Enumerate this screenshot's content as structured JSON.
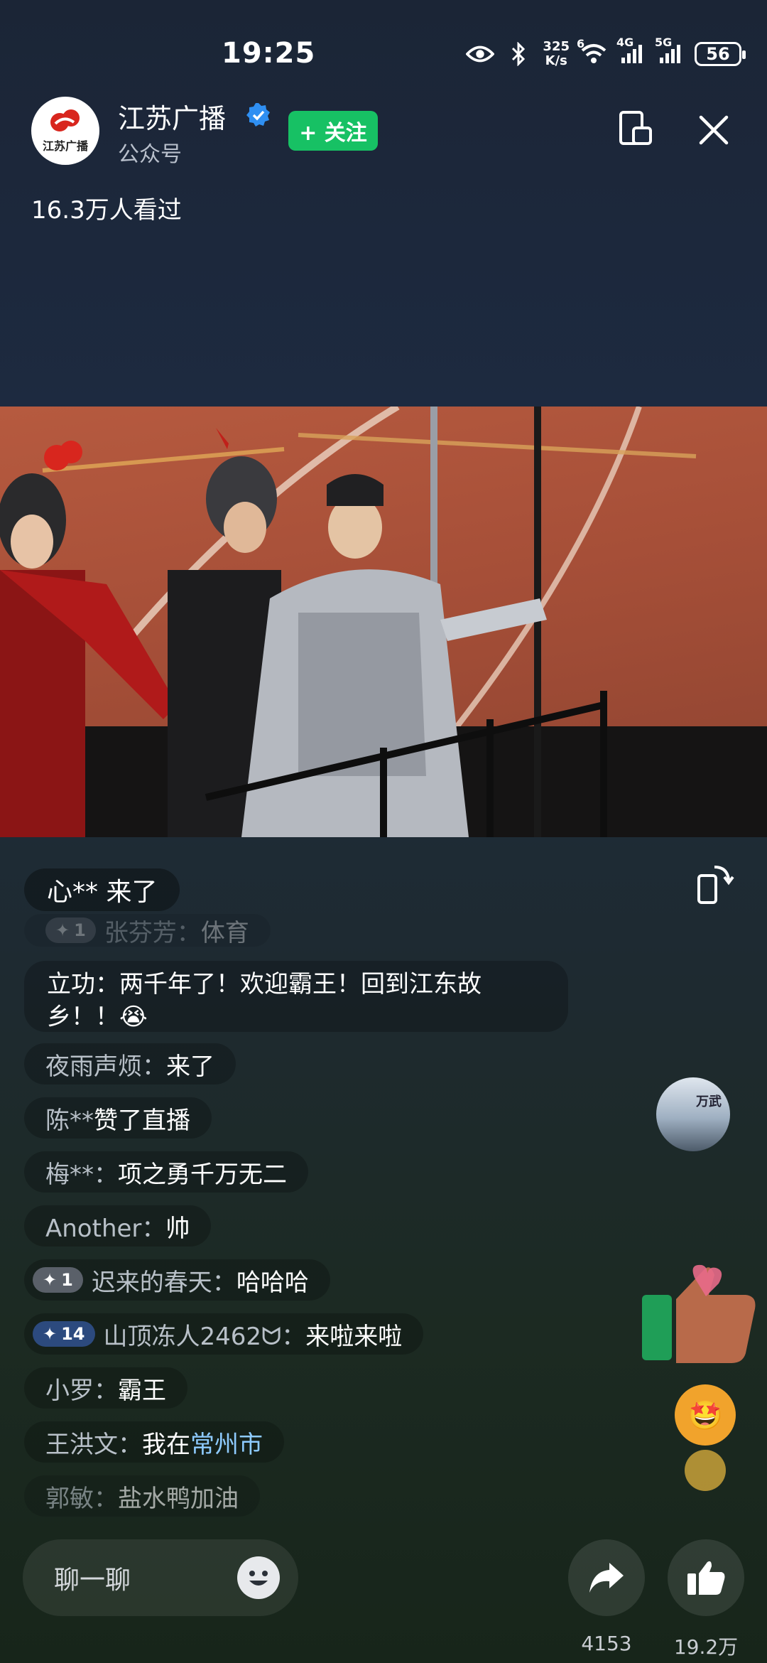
{
  "status_bar": {
    "time": "19:25",
    "net_speed_value": "325",
    "net_speed_unit": "K/s",
    "wifi_label": "6",
    "network_1": "4G",
    "network_2": "5G",
    "battery": "56"
  },
  "header": {
    "account_name": "江苏广播",
    "account_type": "公众号",
    "logo_text": "江苏广播",
    "follow_label": "+ 关注",
    "viewers": "16.3万人看过"
  },
  "entry_notice": "心** 来了",
  "comments": [
    {
      "badge": "1",
      "user": "张芬芳：",
      "msg": "体育"
    },
    {
      "user": "立功：",
      "msg": "两千年了！欢迎霸王！回到江东故乡！！😭"
    },
    {
      "user": "夜雨声烦：",
      "msg": "来了"
    },
    {
      "user": "陈** ",
      "msg": "赞了直播"
    },
    {
      "user": "梅**：",
      "msg": "项之勇千万无二"
    },
    {
      "user": "Another：",
      "msg": "帅"
    },
    {
      "badge": "1",
      "user": "迟来的春天：",
      "msg": "哈哈哈"
    },
    {
      "badge": "14",
      "user": "山顶冻人2462ᗢ：",
      "msg": "来啦来啦"
    },
    {
      "user": "小罗：",
      "msg": "霸王"
    },
    {
      "user": "王洪文：",
      "msg": "我在",
      "highlight": "常州市"
    },
    {
      "user": "郭敏：",
      "msg": "盐水鸭加油"
    }
  ],
  "float_avatar_text": "万武",
  "bottom": {
    "chat_placeholder": "聊一聊",
    "share_count": "4153",
    "like_count": "19.2万"
  },
  "colors": {
    "follow_green": "#17c164",
    "verified_blue": "#2f8ff2",
    "highlight_blue": "#8ecbff"
  }
}
